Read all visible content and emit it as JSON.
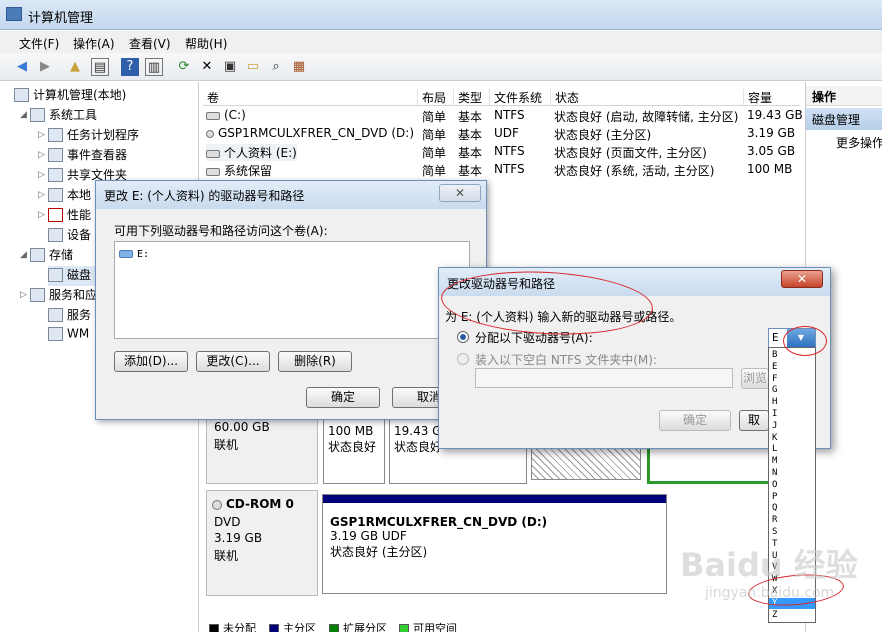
{
  "window": {
    "title": "计算机管理"
  },
  "menu": [
    "文件(F)",
    "操作(A)",
    "查看(V)",
    "帮助(H)"
  ],
  "toolbar_icons": [
    "back-arrow-icon",
    "forward-arrow-icon",
    "up-folder-icon",
    "show-hide-tree-icon",
    "help-icon",
    "properties-view-icon",
    "refresh-icon",
    "delete-icon",
    "properties-icon",
    "open-icon",
    "search-icon",
    "export-icon"
  ],
  "tree": {
    "root": "计算机管理(本地)",
    "system_tools": "系统工具",
    "task_scheduler": "任务计划程序",
    "event_viewer": "事件查看器",
    "shared_folders": "共享文件夹",
    "local_users": "本地",
    "performance": "性能",
    "device_manager": "设备",
    "storage": "存储",
    "disk_management": "磁盘",
    "services_apps": "服务和应",
    "services": "服务",
    "wmi": "WM"
  },
  "volume_table": {
    "headers": [
      "卷",
      "布局",
      "类型",
      "文件系统",
      "状态",
      "容量"
    ],
    "rows": [
      {
        "name": "(C:)",
        "layout": "简单",
        "type": "基本",
        "fs": "NTFS",
        "status": "状态良好 (启动, 故障转储, 主分区)",
        "size": "19.43 GB"
      },
      {
        "name": "GSP1RMCULXFRER_CN_DVD (D:)",
        "layout": "简单",
        "type": "基本",
        "fs": "UDF",
        "status": "状态良好 (主分区)",
        "size": "3.19 GB"
      },
      {
        "name": "个人资料 (E:)",
        "layout": "简单",
        "type": "基本",
        "fs": "NTFS",
        "status": "状态良好 (页面文件, 主分区)",
        "size": "3.05 GB"
      },
      {
        "name": "系统保留",
        "layout": "简单",
        "type": "基本",
        "fs": "NTFS",
        "status": "状态良好 (系统, 活动, 主分区)",
        "size": "100 MB"
      }
    ]
  },
  "disk0": {
    "size": "60.00 GB",
    "state": "联机",
    "part1": {
      "size": "100 MB",
      "status": "状态良好"
    },
    "part2": {
      "size": "19.43 GB",
      "status": "状态良好"
    }
  },
  "cdrom": {
    "name": "CD-ROM 0",
    "kind": "DVD",
    "size": "3.19 GB",
    "state": "联机",
    "volume_name": "GSP1RMCULXFRER_CN_DVD (D:)",
    "volume_size": "3.19 GB UDF",
    "volume_status": "状态良好 (主分区)"
  },
  "legend": [
    {
      "label": "未分配",
      "color": "#000000"
    },
    {
      "label": "主分区",
      "color": "#00007a"
    },
    {
      "label": "扩展分区",
      "color": "#008000"
    },
    {
      "label": "可用空间",
      "color": "#33cc33"
    }
  ],
  "actions": {
    "header": "操作",
    "sub": "磁盘管理",
    "more": "更多操作"
  },
  "dialog1": {
    "title": "更改 E: (个人资料) 的驱动器号和路径",
    "instruction": "可用下列驱动器号和路径访问这个卷(A):",
    "entry": "E:",
    "add": "添加(D)...",
    "change": "更改(C)...",
    "remove": "删除(R)",
    "ok": "确定",
    "cancel": "取消"
  },
  "dialog2": {
    "title": "更改驱动器号和路径",
    "prompt": "为 E: (个人资料) 输入新的驱动器号或路径。",
    "assign_letter": "分配以下驱动器号(A):",
    "mount_folder": "装入以下空白 NTFS 文件夹中(M):",
    "browse": "浏览",
    "ok": "确定",
    "cancel": "取"
  },
  "dropdown": {
    "value": "E",
    "options": [
      "B",
      "E",
      "F",
      "G",
      "H",
      "I",
      "J",
      "K",
      "L",
      "M",
      "N",
      "O",
      "P",
      "Q",
      "R",
      "S",
      "T",
      "U",
      "V",
      "W",
      "X",
      "Y",
      "Z"
    ],
    "highlighted": "Y"
  },
  "watermark": {
    "logo": "Baidu 经验",
    "url": "jingyan.baidu.com"
  }
}
